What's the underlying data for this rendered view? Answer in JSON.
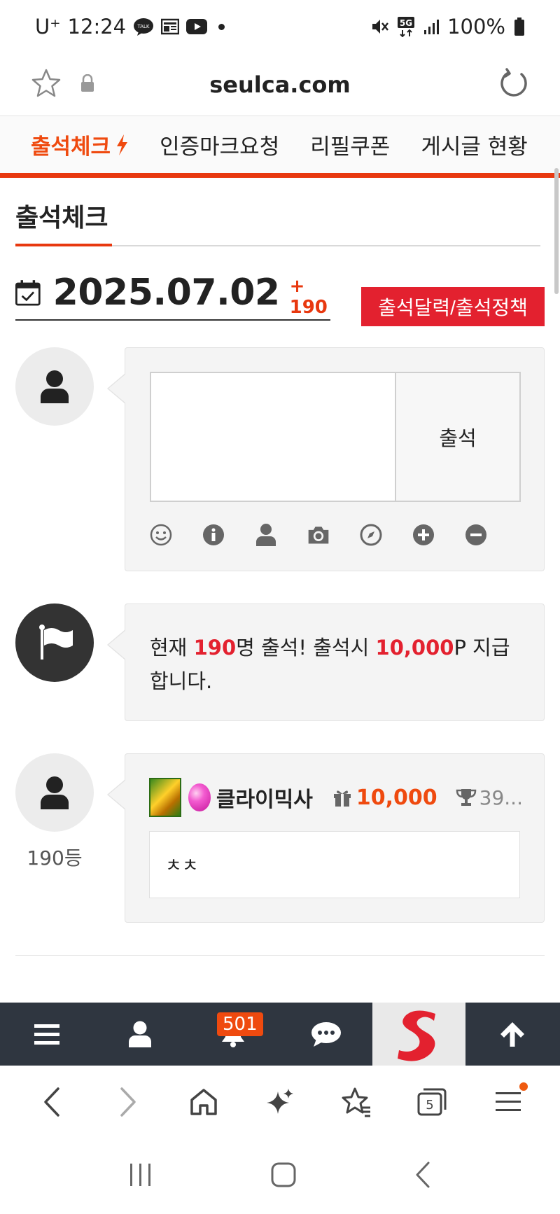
{
  "status_bar": {
    "carrier": "U⁺",
    "time": "12:24",
    "talk_badge": "TALK",
    "network": "5G",
    "battery": "100%"
  },
  "browser": {
    "url": "seulca.com"
  },
  "site_nav": {
    "items": [
      {
        "label": "출석체크",
        "active": true
      },
      {
        "label": "인증마크요청"
      },
      {
        "label": "리필쿠폰"
      },
      {
        "label": "게시글 현황"
      }
    ]
  },
  "page": {
    "title": "출석체크",
    "date": "2025.07.02",
    "count_delta": "+ 190",
    "calendar_button": "출석달력/출석정책"
  },
  "compose": {
    "submit_label": "출석"
  },
  "info": {
    "prefix": "현재 ",
    "count": "190",
    "mid": "명 출석! 출석시 ",
    "points": "10,000",
    "suffix": "P 지급합니다."
  },
  "entry": {
    "name": "클라이믹사",
    "points": "10,000",
    "rank_short": "39...",
    "comment": "ㅊㅊ",
    "place": "190등"
  },
  "site_bottom": {
    "notification_count": "501",
    "logo_letter": "S"
  },
  "colors": {
    "accent": "#e8380f",
    "red": "#e3212f",
    "bottom_bar": "#2f3640"
  }
}
